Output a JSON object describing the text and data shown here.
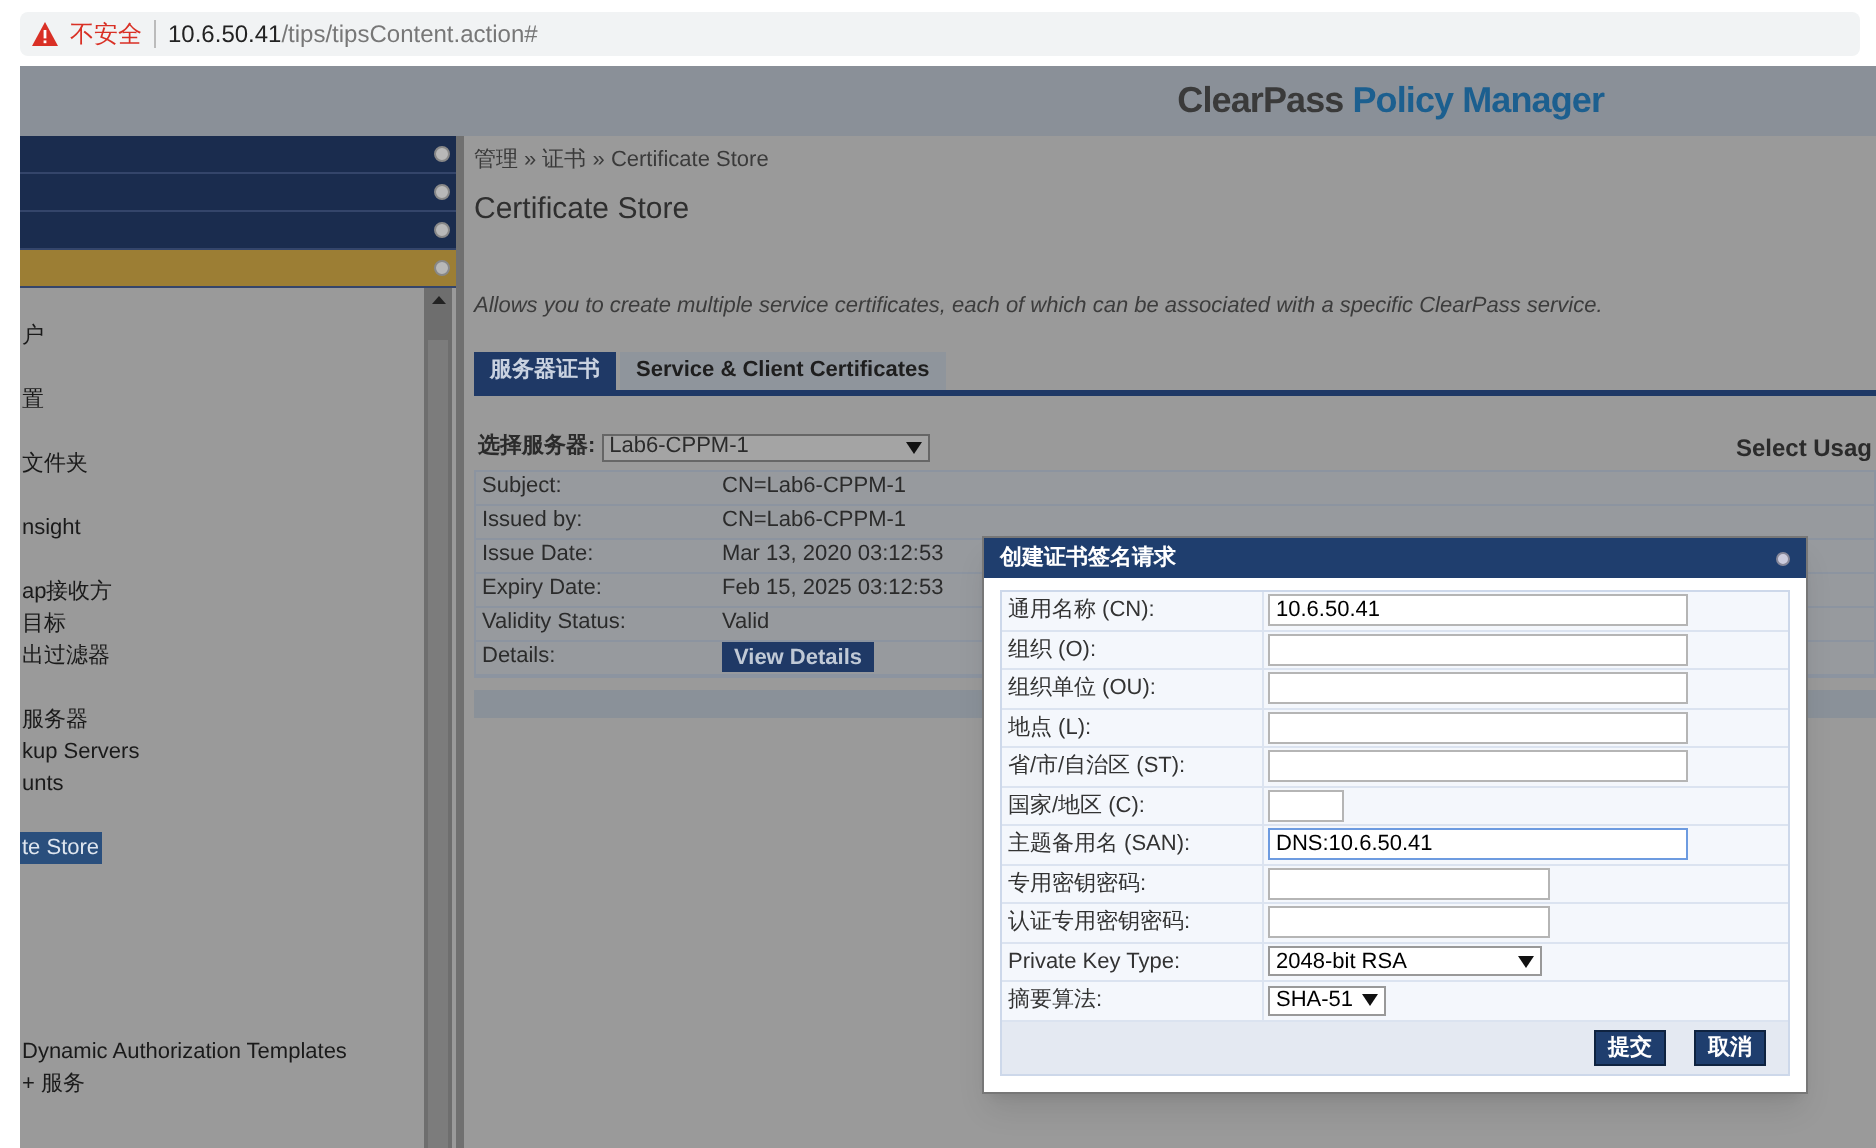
{
  "browser": {
    "security_warning": "不安全",
    "url_host": "10.6.50.41",
    "url_path": "/tips/tipsContent.action#"
  },
  "header": {
    "brand_dark": "ClearPass",
    "brand_blue": "Policy Manager"
  },
  "sidebar": {
    "bars": [
      {
        "kind": "blue"
      },
      {
        "kind": "blue"
      },
      {
        "kind": "blue"
      },
      {
        "kind": "gold"
      }
    ],
    "groups": [
      [
        {
          "label": "户",
          "selected": false
        }
      ],
      [
        {
          "label": "置",
          "selected": false
        }
      ],
      [
        {
          "label": "文件夹",
          "selected": false
        }
      ],
      [
        {
          "label": "nsight",
          "selected": false
        }
      ],
      [
        {
          "label": "ap接收方",
          "selected": false
        },
        {
          "label": "目标",
          "selected": false
        },
        {
          "label": "出过滤器",
          "selected": false
        }
      ],
      [
        {
          "label": "服务器",
          "selected": false
        },
        {
          "label": "kup Servers",
          "selected": false
        },
        {
          "label": "unts",
          "selected": false
        }
      ],
      [
        {
          "label": "te Store",
          "selected": true
        }
      ],
      [
        {
          "label": "Dynamic Authorization Templates",
          "selected": false
        },
        {
          "label": "+ 服务",
          "selected": false
        }
      ]
    ]
  },
  "breadcrumb": "管理 » 证书 » Certificate Store",
  "page_title": "Certificate Store",
  "description": "Allows you to create multiple service certificates, each of which can be associated with a specific ClearPass service.",
  "tabs": [
    {
      "label": "服务器证书",
      "selected": true
    },
    {
      "label": "Service & Client Certificates",
      "selected": false
    }
  ],
  "server_select": {
    "label": "选择服务器:",
    "value": "Lab6-CPPM-1"
  },
  "usage_label": "Select Usag",
  "details": [
    {
      "label": "Subject:",
      "value": "CN=Lab6-CPPM-1"
    },
    {
      "label": "Issued by:",
      "value": "CN=Lab6-CPPM-1"
    },
    {
      "label": "Issue Date:",
      "value": "Mar 13, 2020 03:12:53"
    },
    {
      "label": "Expiry Date:",
      "value": "Feb 15, 2025 03:12:53"
    },
    {
      "label": "Validity Status:",
      "value": "Valid"
    },
    {
      "label": "Details:",
      "kind": "button",
      "value": "View Details"
    }
  ],
  "dialog": {
    "title": "创建证书签名请求",
    "fields": [
      {
        "label": "通用名称 (CN):",
        "kind": "text",
        "value": "10.6.50.41",
        "focused": false
      },
      {
        "label": "组织 (O):",
        "kind": "text",
        "focused": false
      },
      {
        "label": "组织单位 (OU):",
        "kind": "text",
        "focused": false
      },
      {
        "label": "地点 (L):",
        "kind": "text",
        "focused": false
      },
      {
        "label": "省/市/自治区 (ST):",
        "kind": "text",
        "focused": false
      },
      {
        "label": "国家/地区 (C):",
        "kind": "short_text",
        "focused": false
      },
      {
        "label": "主题备用名 (SAN):",
        "kind": "text",
        "value": "DNS:10.6.50.41",
        "focused": true
      },
      {
        "label": "专用密钥密码:",
        "kind": "password",
        "focused": false
      },
      {
        "label": "认证专用密钥密码:",
        "kind": "password",
        "focused": false
      },
      {
        "label": "Private Key Type:",
        "kind": "select",
        "value": "2048-bit RSA"
      },
      {
        "label": "摘要算法:",
        "kind": "small_select",
        "value": "SHA-51"
      }
    ],
    "buttons": [
      "提交",
      "取消"
    ]
  }
}
